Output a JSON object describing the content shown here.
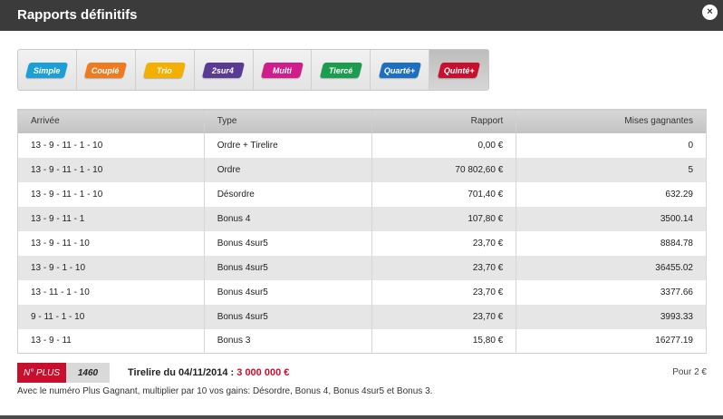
{
  "dialog": {
    "title": "Rapports définitifs",
    "close_label": "×"
  },
  "tabs": [
    {
      "label": "Simple",
      "color": "#1a9fd8"
    },
    {
      "label": "Couplé",
      "color": "#f07a20"
    },
    {
      "label": "Trio",
      "color": "#f4b000"
    },
    {
      "label": "2sur4",
      "color": "#5a3b94"
    },
    {
      "label": "Multi",
      "color": "#cf1e8c"
    },
    {
      "label": "Tiercé",
      "color": "#1b9c4e"
    },
    {
      "label": "Quarté+",
      "color": "#1f6fc0"
    },
    {
      "label": "Quinté+",
      "color": "#c8102e"
    }
  ],
  "active_tab": "Quinté+",
  "table": {
    "headers": [
      "Arrivée",
      "Type",
      "Rapport",
      "Mises gagnantes"
    ],
    "rows": [
      {
        "arrivee": "13 - 9 - 11 - 1 - 10",
        "type": "Ordre + Tirelire",
        "rapport": "0,00 €",
        "mises": "0"
      },
      {
        "arrivee": "13 - 9 - 11 - 1 - 10",
        "type": "Ordre",
        "rapport": "70 802,60 €",
        "mises": "5"
      },
      {
        "arrivee": "13 - 9 - 11 - 1 - 10",
        "type": "Désordre",
        "rapport": "701,40 €",
        "mises": "632.29"
      },
      {
        "arrivee": "13 - 9 - 11 - 1",
        "type": "Bonus 4",
        "rapport": "107,80 €",
        "mises": "3500.14"
      },
      {
        "arrivee": "13 - 9 - 11 - 10",
        "type": "Bonus 4sur5",
        "rapport": "23,70 €",
        "mises": "8884.78"
      },
      {
        "arrivee": "13 - 9 - 1 - 10",
        "type": "Bonus 4sur5",
        "rapport": "23,70 €",
        "mises": "36455.02"
      },
      {
        "arrivee": "13 - 11 - 1 - 10",
        "type": "Bonus 4sur5",
        "rapport": "23,70 €",
        "mises": "3377.66"
      },
      {
        "arrivee": "9 - 11 - 1 - 10",
        "type": "Bonus 4sur5",
        "rapport": "23,70 €",
        "mises": "3993.33"
      },
      {
        "arrivee": "13 - 9 - 11",
        "type": "Bonus 3",
        "rapport": "15,80 €",
        "mises": "16277.19"
      }
    ]
  },
  "footer": {
    "nplus_label": "N° PLUS",
    "nplus_number": "1460",
    "tirelire_label": "Tirelire du 04/11/2014 :",
    "tirelire_amount": "3 000 000 €",
    "pour": "Pour 2 €",
    "note": "Avec le numéro Plus Gagnant, multiplier par 10 vos gains: Désordre, Bonus 4, Bonus 4sur5 et Bonus 3."
  }
}
